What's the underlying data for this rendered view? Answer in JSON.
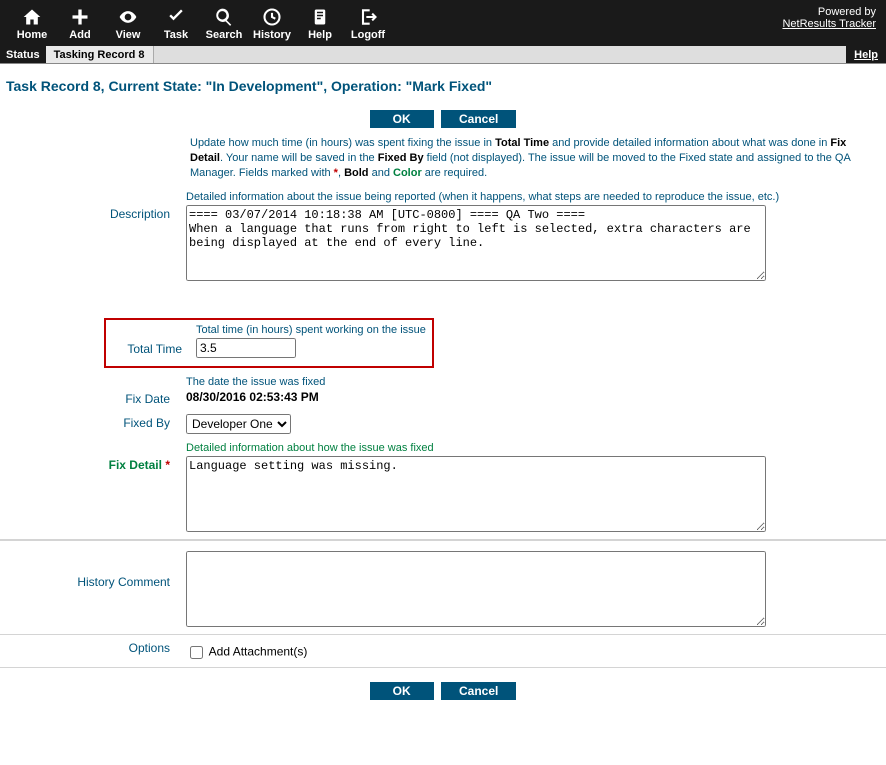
{
  "powered": {
    "text": "Powered by",
    "link": "NetResults Tracker"
  },
  "toolbar": {
    "home": "Home",
    "add": "Add",
    "view": "View",
    "task": "Task",
    "search": "Search",
    "history": "History",
    "help": "Help",
    "logoff": "Logoff"
  },
  "subbar": {
    "status": "Status",
    "record": "Tasking Record 8",
    "help": "Help"
  },
  "title": "Task Record 8, Current State: \"In Development\", Operation: \"Mark Fixed\"",
  "buttons": {
    "ok": "OK",
    "cancel": "Cancel"
  },
  "instructions": {
    "p1a": "Update how much time (in hours) was spent fixing the issue in ",
    "tt": "Total Time",
    "p1b": " and provide detailed information about what was done in ",
    "fd": "Fix Detail",
    "p1c": ". Your name will be saved in the ",
    "fb": "Fixed By",
    "p1d": " field (not displayed). The issue will be moved to the Fixed state and assigned to the QA Manager. Fields marked with ",
    "star": "*",
    "bold": "Bold",
    "and": " and ",
    "color": "Color",
    "p1e": ", ",
    "end": " are required."
  },
  "fields": {
    "description": {
      "label": "Description",
      "hint": "Detailed information about the issue being reported (when it happens, what steps are needed to reproduce the issue, etc.)",
      "value": "==== 03/07/2014 10:18:38 AM [UTC-0800] ==== QA Two ====\nWhen a language that runs from right to left is selected, extra characters are being displayed at the end of every line."
    },
    "totaltime": {
      "label": "Total Time",
      "hint": "Total time (in hours) spent working on the issue",
      "value": "3.5"
    },
    "fixdate": {
      "label": "Fix Date",
      "hint": "The date the issue was fixed",
      "value": "08/30/2016 02:53:43 PM"
    },
    "fixedby": {
      "label": "Fixed By",
      "value": "Developer One"
    },
    "fixdetail": {
      "label": "Fix Detail",
      "star": "*",
      "hint": "Detailed information about how the issue was fixed",
      "value": "Language setting was missing."
    },
    "historycomment": {
      "label": "History Comment",
      "value": ""
    },
    "options": {
      "label": "Options",
      "attach": "Add Attachment(s)"
    }
  }
}
